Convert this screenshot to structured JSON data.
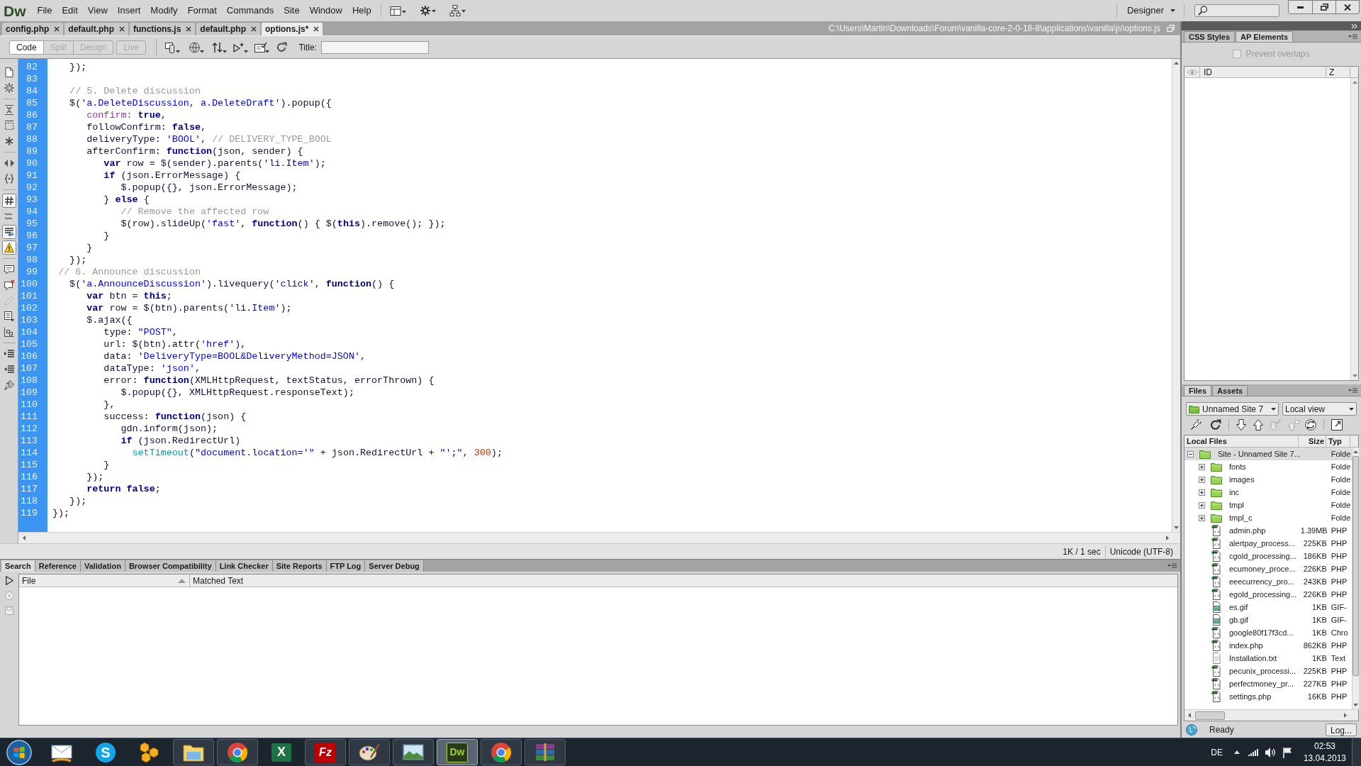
{
  "app_logo": "Dw",
  "menu": [
    "File",
    "Edit",
    "View",
    "Insert",
    "Modify",
    "Format",
    "Commands",
    "Site",
    "Window",
    "Help"
  ],
  "workspace": "Designer",
  "document_tabs": [
    {
      "label": "config.php",
      "selected": false
    },
    {
      "label": "default.php",
      "selected": false
    },
    {
      "label": "functions.js",
      "selected": false
    },
    {
      "label": "default.php",
      "selected": false
    },
    {
      "label": "options.js*",
      "selected": true
    }
  ],
  "file_path": "C:\\Users\\Martin\\Downloads\\Forum\\vanilla-core-2-0-18-8\\applications\\vanilla\\js\\options.js",
  "view_buttons": [
    {
      "label": "Code",
      "selected": true,
      "disabled": false
    },
    {
      "label": "Split",
      "selected": false,
      "disabled": true
    },
    {
      "label": "Design",
      "selected": false,
      "disabled": true
    },
    {
      "label": "Live",
      "selected": false,
      "disabled": true
    }
  ],
  "title_label": "Title:",
  "code_toolbar": [
    {
      "kind": "page",
      "on": false
    },
    {
      "kind": "gear",
      "on": false
    },
    {
      "kind": "separator"
    },
    {
      "kind": "collapse",
      "on": false
    },
    {
      "kind": "dashed-box",
      "on": false
    },
    {
      "kind": "asterisk",
      "on": false
    },
    {
      "kind": "separator"
    },
    {
      "kind": "double-arrow",
      "on": false
    },
    {
      "kind": "braces",
      "on": false
    },
    {
      "kind": "separator"
    },
    {
      "kind": "hash",
      "on": true
    },
    {
      "kind": "wave",
      "on": false
    },
    {
      "kind": "wrap",
      "on": true
    },
    {
      "kind": "warning",
      "on": true
    },
    {
      "kind": "separator"
    },
    {
      "kind": "bubble",
      "on": false
    },
    {
      "kind": "bubble-x",
      "on": false
    },
    {
      "kind": "pencil",
      "on": false
    },
    {
      "kind": "document-lines",
      "on": false
    },
    {
      "kind": "blocks",
      "on": false
    },
    {
      "kind": "separator"
    },
    {
      "kind": "indent",
      "on": false
    },
    {
      "kind": "outdent",
      "on": false
    },
    {
      "kind": "brush",
      "on": false
    }
  ],
  "code_lines": [
    {
      "number": "82",
      "tokens": [
        {
          "kind": "plain",
          "text": "   });"
        }
      ]
    },
    {
      "number": "83"
    },
    {
      "number": "84",
      "tokens": [
        {
          "kind": "comment",
          "text": "   // 5. Delete discussion"
        }
      ]
    },
    {
      "number": "85",
      "tokens": [
        {
          "kind": "plain",
          "text": "   $("
        },
        {
          "kind": "string",
          "text": "'a.DeleteDiscussion, a.DeleteDraft'"
        },
        {
          "kind": "plain",
          "text": ").popup({"
        }
      ]
    },
    {
      "number": "86",
      "tokens": [
        {
          "kind": "reserved",
          "text": "      confirm: "
        },
        {
          "kind": "keyword",
          "text": "true"
        },
        {
          "kind": "plain",
          "text": ","
        }
      ]
    },
    {
      "number": "87",
      "tokens": [
        {
          "kind": "plain",
          "text": "      followConfirm: "
        },
        {
          "kind": "keyword",
          "text": "false"
        },
        {
          "kind": "plain",
          "text": ","
        }
      ]
    },
    {
      "number": "88",
      "tokens": [
        {
          "kind": "plain",
          "text": "      deliveryType: "
        },
        {
          "kind": "string",
          "text": "'BOOL'"
        },
        {
          "kind": "plain",
          "text": ", "
        },
        {
          "kind": "comment",
          "text": "// DELIVERY_TYPE_BOOL"
        }
      ]
    },
    {
      "number": "89",
      "tokens": [
        {
          "kind": "plain",
          "text": "      afterConfirm: "
        },
        {
          "kind": "keyword",
          "text": "function"
        },
        {
          "kind": "plain",
          "text": "(json, sender) {"
        }
      ]
    },
    {
      "number": "90",
      "tokens": [
        {
          "kind": "keyword",
          "text": "         var"
        },
        {
          "kind": "plain",
          "text": " row = $(sender).parents("
        },
        {
          "kind": "string",
          "text": "'li.Item'"
        },
        {
          "kind": "plain",
          "text": ");"
        }
      ]
    },
    {
      "number": "91",
      "tokens": [
        {
          "kind": "keyword",
          "text": "         if"
        },
        {
          "kind": "plain",
          "text": " (json.ErrorMessage) {"
        }
      ]
    },
    {
      "number": "92",
      "tokens": [
        {
          "kind": "plain",
          "text": "            $.popup({}, json.ErrorMessage);"
        }
      ]
    },
    {
      "number": "93",
      "tokens": [
        {
          "kind": "plain",
          "text": "         } "
        },
        {
          "kind": "keyword",
          "text": "else"
        },
        {
          "kind": "plain",
          "text": " {"
        }
      ]
    },
    {
      "number": "94",
      "tokens": [
        {
          "kind": "comment",
          "text": "            // Remove the affected row"
        }
      ]
    },
    {
      "number": "95",
      "tokens": [
        {
          "kind": "plain",
          "text": "            $(row).slideUp("
        },
        {
          "kind": "string",
          "text": "'fast'"
        },
        {
          "kind": "plain",
          "text": ", "
        },
        {
          "kind": "keyword",
          "text": "function"
        },
        {
          "kind": "plain",
          "text": "() { $("
        },
        {
          "kind": "keyword",
          "text": "this"
        },
        {
          "kind": "plain",
          "text": ").remove(); });"
        }
      ]
    },
    {
      "number": "96",
      "tokens": [
        {
          "kind": "plain",
          "text": "         }"
        }
      ]
    },
    {
      "number": "97",
      "tokens": [
        {
          "kind": "plain",
          "text": "      }"
        }
      ]
    },
    {
      "number": "98",
      "tokens": [
        {
          "kind": "plain",
          "text": "   });"
        }
      ]
    },
    {
      "number": "99",
      "tokens": [
        {
          "kind": "comment",
          "text": " // 6. Announce discussion"
        }
      ]
    },
    {
      "number": "100",
      "tokens": [
        {
          "kind": "plain",
          "text": "   $("
        },
        {
          "kind": "string",
          "text": "'a.AnnounceDiscussion'"
        },
        {
          "kind": "plain",
          "text": ").livequery("
        },
        {
          "kind": "string",
          "text": "'click'"
        },
        {
          "kind": "plain",
          "text": ", "
        },
        {
          "kind": "keyword",
          "text": "function"
        },
        {
          "kind": "plain",
          "text": "() {"
        }
      ]
    },
    {
      "number": "101",
      "tokens": [
        {
          "kind": "keyword",
          "text": "      var"
        },
        {
          "kind": "plain",
          "text": " btn = "
        },
        {
          "kind": "keyword",
          "text": "this"
        },
        {
          "kind": "plain",
          "text": ";"
        }
      ]
    },
    {
      "number": "102",
      "tokens": [
        {
          "kind": "keyword",
          "text": "      var"
        },
        {
          "kind": "plain",
          "text": " row = $(btn).parents("
        },
        {
          "kind": "string",
          "text": "'li.Item'"
        },
        {
          "kind": "plain",
          "text": ");"
        }
      ]
    },
    {
      "number": "103",
      "tokens": [
        {
          "kind": "plain",
          "text": "      $.ajax({"
        }
      ]
    },
    {
      "number": "104",
      "tokens": [
        {
          "kind": "plain",
          "text": "         type: "
        },
        {
          "kind": "string",
          "text": "\"POST\""
        },
        {
          "kind": "plain",
          "text": ","
        }
      ]
    },
    {
      "number": "105",
      "tokens": [
        {
          "kind": "plain",
          "text": "         url: $(btn).attr("
        },
        {
          "kind": "string",
          "text": "'href'"
        },
        {
          "kind": "plain",
          "text": "),"
        }
      ]
    },
    {
      "number": "106",
      "tokens": [
        {
          "kind": "plain",
          "text": "         data: "
        },
        {
          "kind": "string",
          "text": "'DeliveryType=BOOL&DeliveryMethod=JSON'"
        },
        {
          "kind": "plain",
          "text": ","
        }
      ]
    },
    {
      "number": "107",
      "tokens": [
        {
          "kind": "plain",
          "text": "         dataType: "
        },
        {
          "kind": "string",
          "text": "'json'"
        },
        {
          "kind": "plain",
          "text": ","
        }
      ]
    },
    {
      "number": "108",
      "tokens": [
        {
          "kind": "plain",
          "text": "         error: "
        },
        {
          "kind": "keyword",
          "text": "function"
        },
        {
          "kind": "plain",
          "text": "(XMLHttpRequest, textStatus, errorThrown) {"
        }
      ]
    },
    {
      "number": "109",
      "tokens": [
        {
          "kind": "plain",
          "text": "            $.popup({}, XMLHttpRequest.responseText);"
        }
      ]
    },
    {
      "number": "110",
      "tokens": [
        {
          "kind": "plain",
          "text": "         },"
        }
      ]
    },
    {
      "number": "111",
      "tokens": [
        {
          "kind": "plain",
          "text": "         success: "
        },
        {
          "kind": "keyword",
          "text": "function"
        },
        {
          "kind": "plain",
          "text": "(json) {"
        }
      ]
    },
    {
      "number": "112",
      "tokens": [
        {
          "kind": "plain",
          "text": "            gdn.inform(json);"
        }
      ]
    },
    {
      "number": "113",
      "tokens": [
        {
          "kind": "keyword",
          "text": "            if"
        },
        {
          "kind": "plain",
          "text": " (json.RedirectUrl)"
        }
      ]
    },
    {
      "number": "114",
      "tokens": [
        {
          "kind": "builtin",
          "text": "              setTimeout"
        },
        {
          "kind": "plain",
          "text": "("
        },
        {
          "kind": "string",
          "text": "\"document.location='\""
        },
        {
          "kind": "plain",
          "text": " + json.RedirectUrl + "
        },
        {
          "kind": "string",
          "text": "\"';\""
        },
        {
          "kind": "plain",
          "text": ", "
        },
        {
          "kind": "number",
          "text": "300"
        },
        {
          "kind": "plain",
          "text": ");"
        }
      ]
    },
    {
      "number": "115",
      "tokens": [
        {
          "kind": "plain",
          "text": "         }"
        }
      ]
    },
    {
      "number": "116",
      "tokens": [
        {
          "kind": "plain",
          "text": "      });"
        }
      ]
    },
    {
      "number": "117",
      "tokens": [
        {
          "kind": "keyword",
          "text": "      return false"
        },
        {
          "kind": "plain",
          "text": ";"
        }
      ]
    },
    {
      "number": "118",
      "tokens": [
        {
          "kind": "plain",
          "text": "   });"
        }
      ]
    },
    {
      "number": "119",
      "tokens": [
        {
          "kind": "plain",
          "text": "});"
        }
      ]
    }
  ],
  "status_bar": {
    "download": "1K / 1 sec",
    "encoding": "Unicode (UTF-8)"
  },
  "results_panel": {
    "tabs": [
      {
        "label": "Search",
        "selected": true
      },
      {
        "label": "Reference",
        "selected": false
      },
      {
        "label": "Validation",
        "selected": false
      },
      {
        "label": "Browser Compatibility",
        "selected": false
      },
      {
        "label": "Link Checker",
        "selected": false
      },
      {
        "label": "Site Reports",
        "selected": false
      },
      {
        "label": "FTP Log",
        "selected": false
      },
      {
        "label": "Server Debug",
        "selected": false
      }
    ],
    "columns": [
      "File",
      "Matched Text"
    ]
  },
  "ap_elements_panel": {
    "tabs": [
      {
        "label": "CSS Styles",
        "selected": false
      },
      {
        "label": "AP Elements",
        "selected": true
      }
    ],
    "prevent_overlaps": {
      "label": "Prevent overlaps",
      "checked": false,
      "disabled": true
    },
    "columns": [
      "ID",
      "Z"
    ]
  },
  "files_panel": {
    "tabs": [
      {
        "label": "Files",
        "selected": true
      },
      {
        "label": "Assets",
        "selected": false
      }
    ],
    "site": "Unnamed Site 7",
    "view": "Local view",
    "columns": [
      "Local Files",
      "Size",
      "Typ"
    ],
    "tree": [
      {
        "name": "Site - Unnamed Site 7...",
        "type": "Folde",
        "kind": "site",
        "expanded": true,
        "selected": true,
        "children": [
          {
            "name": "fonts",
            "type": "Folde",
            "kind": "folder",
            "expanded": false,
            "selected": false
          },
          {
            "name": "images",
            "type": "Folde",
            "kind": "folder",
            "expanded": false,
            "selected": false
          },
          {
            "name": "inc",
            "type": "Folde",
            "kind": "folder",
            "expanded": false,
            "selected": false
          },
          {
            "name": "tmpl",
            "type": "Folde",
            "kind": "folder",
            "expanded": false,
            "selected": false
          },
          {
            "name": "tmpl_c",
            "type": "Folde",
            "kind": "folder",
            "expanded": false,
            "selected": false
          },
          {
            "name": "admin.php",
            "size": "1.39MB",
            "type": "PHP",
            "kind": "code",
            "selected": false
          },
          {
            "name": "alertpay_process...",
            "size": "225KB",
            "type": "PHP",
            "kind": "code",
            "selected": false
          },
          {
            "name": "cgold_processing...",
            "size": "186KB",
            "type": "PHP",
            "kind": "code",
            "selected": false
          },
          {
            "name": "ecumoney_proce...",
            "size": "226KB",
            "type": "PHP",
            "kind": "code",
            "selected": false
          },
          {
            "name": "eeecurrency_pro...",
            "size": "243KB",
            "type": "PHP",
            "kind": "code",
            "selected": false
          },
          {
            "name": "egold_processing...",
            "size": "226KB",
            "type": "PHP",
            "kind": "code",
            "selected": false
          },
          {
            "name": "es.gif",
            "size": "1KB",
            "type": "GIF-",
            "kind": "image",
            "selected": false
          },
          {
            "name": "gb.gif",
            "size": "1KB",
            "type": "GIF-",
            "kind": "image",
            "selected": false
          },
          {
            "name": "google80f17f3cd...",
            "size": "1KB",
            "type": "Chro",
            "kind": "code",
            "selected": false
          },
          {
            "name": "index.php",
            "size": "862KB",
            "type": "PHP",
            "kind": "code",
            "selected": false
          },
          {
            "name": "Installation.txt",
            "size": "1KB",
            "type": "Text",
            "kind": "text",
            "selected": false
          },
          {
            "name": "pecunix_processi...",
            "size": "225KB",
            "type": "PHP",
            "kind": "code",
            "selected": false
          },
          {
            "name": "perfectmoney_pr...",
            "size": "227KB",
            "type": "PHP",
            "kind": "code",
            "selected": false
          },
          {
            "name": "settings.php",
            "size": "16KB",
            "type": "PHP",
            "kind": "code",
            "selected": false
          }
        ]
      }
    ],
    "status": "Ready",
    "log_button": "Log..."
  },
  "taskbar": {
    "items": [
      {
        "kind": "mail",
        "running": false,
        "active": false
      },
      {
        "kind": "chat",
        "label": "S",
        "running": false,
        "active": false
      },
      {
        "kind": "tools",
        "running": false,
        "active": false
      },
      {
        "kind": "folder",
        "running": true,
        "active": false
      },
      {
        "kind": "browser",
        "running": true,
        "active": false
      },
      {
        "kind": "spreadsheet",
        "label": "X",
        "running": false,
        "active": false
      },
      {
        "kind": "ftp",
        "label": "Fz",
        "running": true,
        "active": false
      },
      {
        "kind": "paint",
        "running": true,
        "active": false
      },
      {
        "kind": "photos",
        "running": true,
        "active": false
      },
      {
        "kind": "editor",
        "label": "Dw",
        "running": true,
        "active": true
      },
      {
        "kind": "browser",
        "running": true,
        "active": false
      },
      {
        "kind": "archive",
        "running": true,
        "active": false
      }
    ],
    "language": "DE",
    "time": "02:53",
    "date": "13.04.2013"
  }
}
